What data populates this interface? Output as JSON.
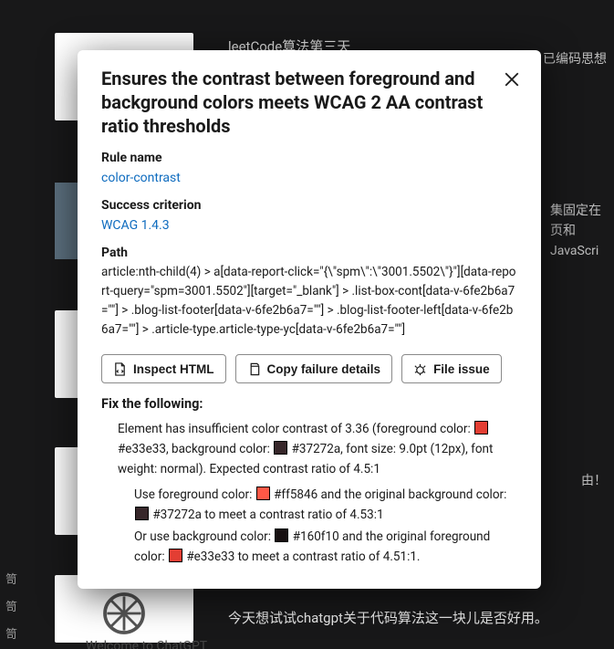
{
  "background": {
    "top_title": "leetCode算法第三天",
    "right1": "已编码思想",
    "right2": "集固定在页和JavaScri",
    "right3": "由！",
    "chat_line": "今天想试试chatgpt关于代码算法这一块儿是否好用。",
    "welcome": "Welcome to ChatGPT",
    "side": {
      "a": "笥",
      "b": "笥",
      "c": "笥"
    }
  },
  "modal": {
    "title": "Ensures the contrast between foreground and background colors meets WCAG 2 AA contrast ratio thresholds",
    "rule_label": "Rule name",
    "rule_link": "color-contrast",
    "criterion_label": "Success criterion",
    "criterion_link": "WCAG 1.4.3",
    "path_label": "Path",
    "path_value": "article:nth-child(4) > a[data-report-click=\"{\\\"spm\\\":\\\"3001.5502\\\"}\"][data-report-query=\"spm=3001.5502\"][target=\"_blank\"] > .list-box-cont[data-v-6fe2b6a7=\"\"] > .blog-list-footer[data-v-6fe2b6a7=\"\"] > .blog-list-footer-left[data-v-6fe2b6a7=\"\"] > .article-type.article-type-yc[data-v-6fe2b6a7=\"\"]",
    "buttons": {
      "inspect": "Inspect HTML",
      "copy": "Copy failure details",
      "file": "File issue"
    },
    "fix_heading": "Fix the following:",
    "fix_main_1": "Element has insufficient color contrast of 3.36 (foreground color: ",
    "fix_main_2": "#e33e33, background color: ",
    "fix_main_3": "#37272a, font size: 9.0pt (12px), font weight: normal). Expected contrast ratio of 4.5:1",
    "fix_alt1_1": "Use foreground color: ",
    "fix_alt1_2": "#ff5846 and the original background color: ",
    "fix_alt1_3": "#37272a to meet a contrast ratio of 4.53:1",
    "fix_alt2_1": "Or use background color: ",
    "fix_alt2_2": "#160f10 and the original foreground color: ",
    "fix_alt2_3": "#e33e33 to meet a contrast ratio of 4.51:1.",
    "colors": {
      "fg": "#e33e33",
      "bg": "#37272a",
      "alt_fg": "#ff5846",
      "alt_bg": "#160f10"
    }
  }
}
